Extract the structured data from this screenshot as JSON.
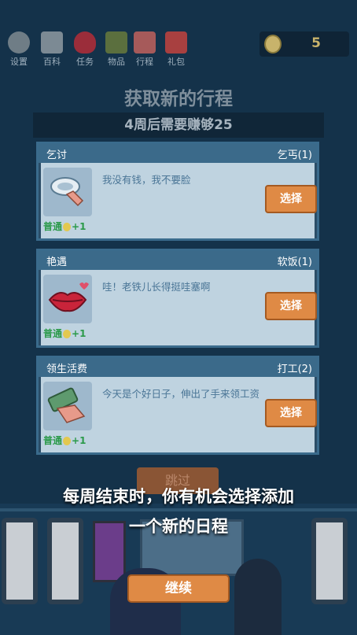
{
  "toolbar": {
    "items": [
      {
        "label": "设置",
        "icon": "gear-icon",
        "color": "#6f7d86"
      },
      {
        "label": "百科",
        "icon": "book-icon",
        "color": "#7c8a94"
      },
      {
        "label": "任务",
        "icon": "heart-icon",
        "color": "#9b2d3a"
      },
      {
        "label": "物品",
        "icon": "bookshelf-icon",
        "color": "#5b6f3e"
      },
      {
        "label": "行程",
        "icon": "calendar-icon",
        "color": "#a65a5a"
      },
      {
        "label": "礼包",
        "icon": "gift-icon",
        "color": "#a84040"
      }
    ],
    "coins": "5"
  },
  "title": "获取新的行程",
  "goal": "4周后需要赚够25",
  "cards": [
    {
      "name": "乞讨",
      "category": "乞丐(1)",
      "desc": "我没有钱，我不要脸",
      "button": "选择",
      "rarity": "普通",
      "bonus": "+1",
      "icon": "begging-bowl-icon"
    },
    {
      "name": "艳遇",
      "category": "软饭(1)",
      "desc": "哇！老铁儿长得挺哇塞啊",
      "button": "选择",
      "rarity": "普通",
      "bonus": "+1",
      "icon": "lips-icon"
    },
    {
      "name": "领生活费",
      "category": "打工(2)",
      "desc": "今天是个好日子，伸出了手来领工资",
      "button": "选择",
      "rarity": "普通",
      "bonus": "+1",
      "icon": "money-hand-icon"
    }
  ],
  "skip": "跳过",
  "message_line1": "每周结束时，你有机会选择添加",
  "message_line2": "一个新的日程",
  "continue": "继续",
  "colors": {
    "accent": "#df8a45",
    "card_header": "#3b6a8a",
    "rarity": "#2b9a4a",
    "background": "#14324a"
  }
}
